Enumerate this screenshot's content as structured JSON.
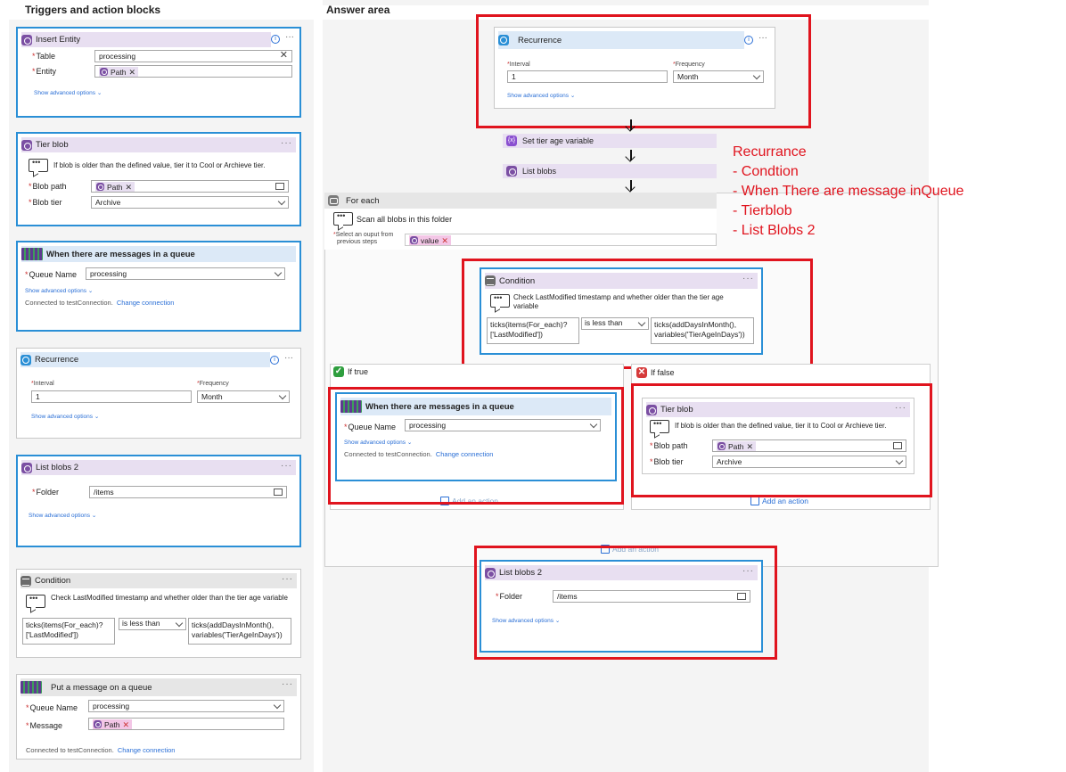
{
  "left_panel": {
    "title": "Triggers and action blocks",
    "insert_entity": {
      "title": "Insert Entity",
      "table_label": "Table",
      "table_value": "processing",
      "entity_label": "Entity",
      "entity_token": "Path",
      "advanced": "Show advanced options"
    },
    "tier_blob": {
      "title": "Tier blob",
      "description": "If blob is older than the defined value, tier it to Cool or Archieve tier.",
      "blob_path_label": "Blob path",
      "blob_path_token": "Path",
      "blob_tier_label": "Blob tier",
      "blob_tier_value": "Archive"
    },
    "queue_messages": {
      "title": "When there are messages in a queue",
      "queue_name_label": "Queue Name",
      "queue_name_value": "processing",
      "advanced": "Show advanced options",
      "connected": "Connected to testConnection.",
      "change": "Change connection"
    },
    "recurrence": {
      "title": "Recurrence",
      "interval_label": "Interval",
      "interval_value": "1",
      "frequency_label": "Frequency",
      "frequency_value": "Month",
      "advanced": "Show advanced options"
    },
    "list_blobs": {
      "title": "List blobs 2",
      "folder_label": "Folder",
      "folder_value": "/items",
      "advanced": "Show advanced options"
    },
    "condition": {
      "title": "Condition",
      "description": "Check LastModified timestamp and whether older than the tier age variable",
      "left_operand_1": "ticks(items(For_each)?",
      "left_operand_2": "['LastModified'])",
      "operator": "is less than",
      "right_operand_1": "ticks(addDaysInMonth(),",
      "right_operand_2": "variables('TierAgeInDays'))"
    },
    "put_message": {
      "title": "Put a message on a queue",
      "queue_name_label": "Queue Name",
      "queue_name_value": "processing",
      "message_label": "Message",
      "message_token": "Path",
      "connected": "Connected to testConnection.",
      "change": "Change connection"
    }
  },
  "answer": {
    "title": "Answer area",
    "recurrence": {
      "title": "Recurrence",
      "interval_label": "Interval",
      "interval_value": "1",
      "frequency_label": "Frequency",
      "frequency_value": "Month",
      "advanced": "Show advanced options"
    },
    "set_tier": "Set tier age variable",
    "list_blobs": "List blobs",
    "for_each": {
      "title": "For each",
      "scan": "Scan all blobs in this folder",
      "select_output_1": "Select an ouput from",
      "select_output_2": "previous steps",
      "value_token": "value"
    },
    "condition": {
      "title": "Condition",
      "description_1": "Check LastModified timestamp and whether older than the tier age",
      "description_2": "variable",
      "left_operand_1": "ticks(items(For_each)?",
      "left_operand_2": "['LastModified'])",
      "operator": "is less than",
      "right_operand_1": "ticks(addDaysInMonth(),",
      "right_operand_2": "variables('TierAgeInDays'))"
    },
    "if_true": {
      "label": "If true",
      "queue": {
        "title": "When there are messages in a queue",
        "queue_name_label": "Queue Name",
        "queue_name_value": "processing",
        "advanced": "Show advanced options",
        "connected": "Connected to testConnection.",
        "change": "Change connection"
      },
      "add_action": "Add an action"
    },
    "if_false": {
      "label": "If false",
      "tier_blob": {
        "title": "Tier blob",
        "description": "If blob is older than the defined value, tier it to Cool or Archieve tier.",
        "blob_path_label": "Blob path",
        "blob_path_token": "Path",
        "blob_tier_label": "Blob tier",
        "blob_tier_value": "Archive"
      },
      "add_action": "Add an action"
    },
    "bottom_add_action": "Add an action",
    "list_blobs_2": {
      "title": "List blobs 2",
      "folder_label": "Folder",
      "folder_value": "/items",
      "advanced": "Show advanced options"
    }
  },
  "note": {
    "line1": "Recurrance",
    "line2": "- Condtion",
    "line3": "- When There are message inQueue",
    "line4": "- Tierblob",
    "line5": "- List Blobs 2"
  },
  "colors": {
    "selection_frame": "#e0141e",
    "card_border": "#2a8fd6",
    "link": "#2a6fd6"
  }
}
